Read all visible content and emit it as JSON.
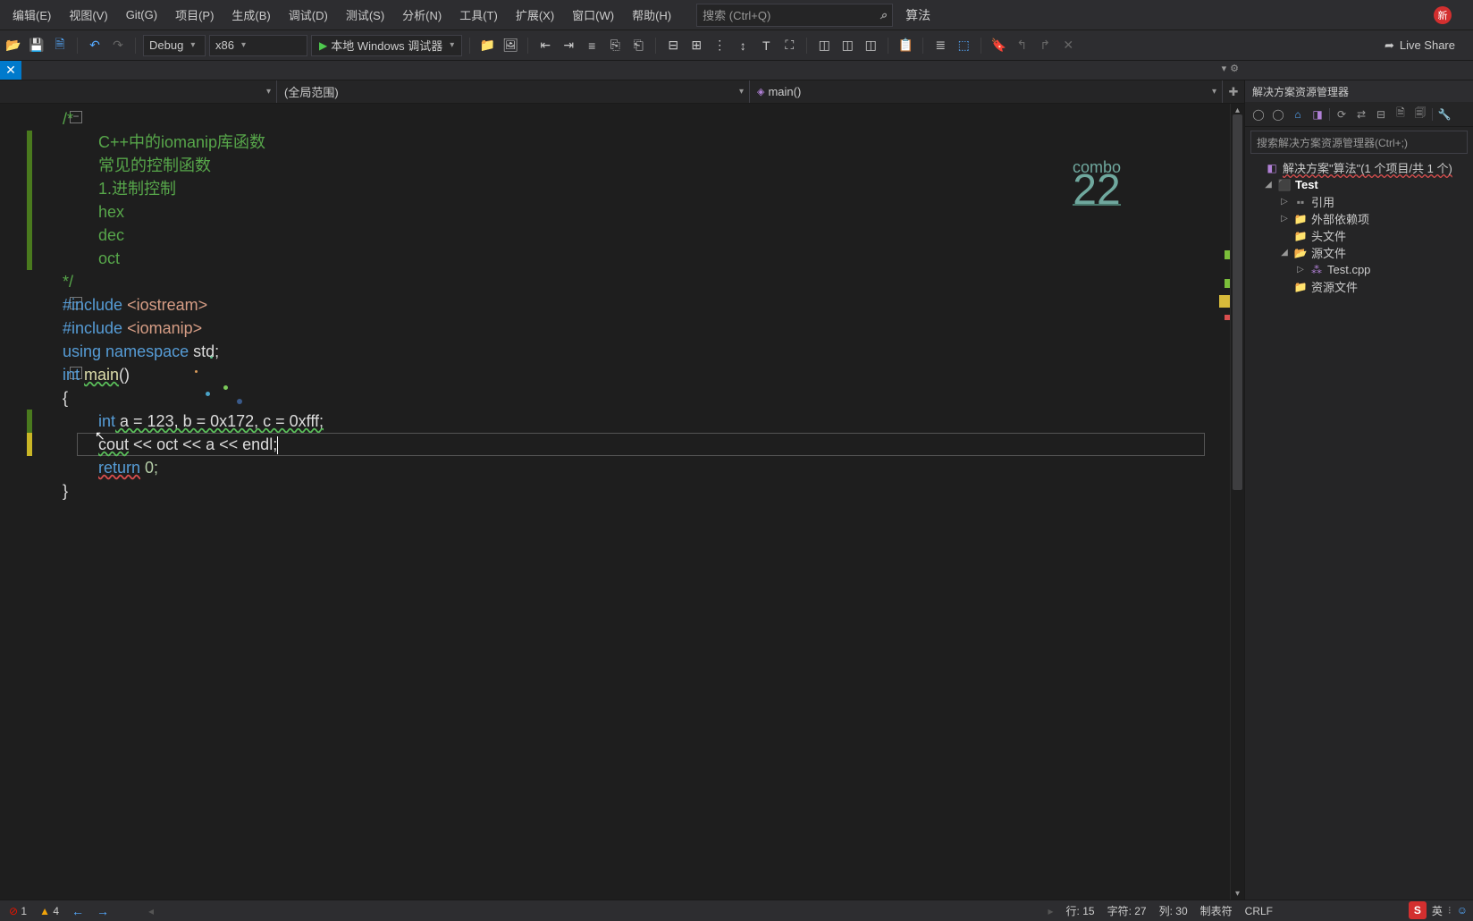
{
  "menu": {
    "items": [
      "编辑(E)",
      "视图(V)",
      "Git(G)",
      "项目(P)",
      "生成(B)",
      "调试(D)",
      "测试(S)",
      "分析(N)",
      "工具(T)",
      "扩展(X)",
      "窗口(W)",
      "帮助(H)"
    ],
    "search_placeholder": "搜索 (Ctrl+Q)",
    "project_label": "算法",
    "new_badge": "新"
  },
  "toolbar": {
    "config": "Debug",
    "platform": "x86",
    "debug_target": "本地 Windows 调试器",
    "live_share": "Live Share"
  },
  "scope": {
    "global": "(全局范围)",
    "member_icon": "◈",
    "member": "main()"
  },
  "combo_counter": {
    "label": "combo",
    "value": "22"
  },
  "code": {
    "comment_open": "/*",
    "c1": "C++中的iomanip库函数",
    "c2": "常见的控制函数",
    "c3": "1.进制控制",
    "c4": "hex",
    "c5": "dec",
    "c6": "oct",
    "comment_close": "*/",
    "inc1a": "#include ",
    "inc1b": "<iostream>",
    "inc2a": "#include ",
    "inc2b": "<iomanip>",
    "using_kw": "using",
    "ns_kw": "namespace",
    "std": "std",
    "semi": ";",
    "int_kw": "int",
    "main_fn": "main",
    "parens": "()",
    "lbrace": "{",
    "rbrace": "}",
    "decl_int": "int",
    "decl_rest": " a = 123, b = 0x172, c = 0xfff;",
    "cout": "cout",
    "oct": "oct",
    "a": "a",
    "endl": "endl",
    "lshift": " << ",
    "return_kw": "return",
    "zero": " 0;"
  },
  "solution": {
    "header": "解决方案资源管理器",
    "search_placeholder": "搜索解决方案资源管理器(Ctrl+;)",
    "root": "解决方案\"算法\"(1 个项目/共 1 个)",
    "project": "Test",
    "refs": "引用",
    "external": "外部依赖项",
    "headers": "头文件",
    "sources": "源文件",
    "file": "Test.cpp",
    "resources": "资源文件"
  },
  "status": {
    "errors": "1",
    "warnings": "4",
    "line_label": "行: 15",
    "char_label": "字符: 27",
    "col_label": "列: 30",
    "tabs_label": "制表符",
    "lineend": "CRLF",
    "ime": "英"
  }
}
